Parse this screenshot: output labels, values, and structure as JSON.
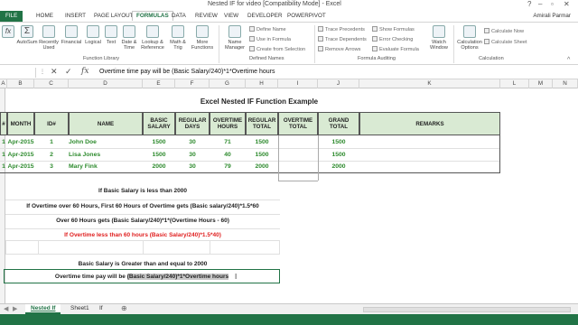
{
  "window": {
    "title": "Nested IF for video  [Compatibility Mode] - Excel"
  },
  "ribbon": {
    "tabs": [
      "FILE",
      "HOME",
      "INSERT",
      "PAGE LAYOUT",
      "FORMULAS",
      "DATA",
      "REVIEW",
      "VIEW",
      "DEVELOPER",
      "POWERPIVOT"
    ],
    "active_tab": "FORMULAS",
    "user": "Amirali Parmar",
    "buttons": {
      "autosum": "AutoSum",
      "recently_used": "Recently Used",
      "financial": "Financial",
      "logical": "Logical",
      "text": "Text",
      "date_time": "Date & Time",
      "lookup": "Lookup & Reference",
      "math": "Math & Trig",
      "more": "More Functions",
      "name_manager": "Name Manager",
      "watch_window": "Watch Window",
      "calc_options": "Calculation Options"
    },
    "small": {
      "define_name": "Define Name",
      "use_in_formula": "Use in Formula",
      "create_from_selection": "Create from Selection",
      "trace_precedents": "Trace Precedents",
      "trace_dependents": "Trace Dependents",
      "remove_arrows": "Remove Arrows",
      "show_formulas": "Show Formulas",
      "error_checking": "Error Checking",
      "evaluate_formula": "Evaluate Formula",
      "calc_now": "Calculate Now",
      "calc_sheet": "Calculate Sheet"
    },
    "groups": {
      "function_library": "Function Library",
      "defined_names": "Defined Names",
      "formula_auditing": "Formula Auditing",
      "calculation": "Calculation"
    }
  },
  "formula_bar": {
    "content": "Overtime time pay will be (Basic Salary/240)*1*Overtime hours"
  },
  "columns": [
    "A",
    "B",
    "C",
    "D",
    "E",
    "F",
    "G",
    "H",
    "I",
    "J",
    "K",
    "L",
    "M",
    "N"
  ],
  "sheet": {
    "title": "Excel Nested IF Function Example",
    "headers": [
      "#",
      "MONTH",
      "ID#",
      "NAME",
      "BASIC SALARY",
      "REGULAR DAYS",
      "OVERTIME HOURS",
      "REGULAR TOTAL",
      "OVERTIME TOTAL",
      "GRAND TOTAL",
      "REMARKS"
    ],
    "rows": [
      {
        "num": "1",
        "month": "Apr-2015",
        "id": "1",
        "name": "John Doe",
        "salary": "1500",
        "days": "30",
        "ot_hours": "71",
        "reg_total": "1500",
        "ot_total": "",
        "grand_total": "1500",
        "remarks": ""
      },
      {
        "num": "1",
        "month": "Apr-2015",
        "id": "2",
        "name": "Lisa Jones",
        "salary": "1500",
        "days": "30",
        "ot_hours": "40",
        "reg_total": "1500",
        "ot_total": "",
        "grand_total": "1500",
        "remarks": ""
      },
      {
        "num": "1",
        "month": "Apr-2015",
        "id": "3",
        "name": "Mary Fink",
        "salary": "2000",
        "days": "30",
        "ot_hours": "79",
        "reg_total": "2000",
        "ot_total": "",
        "grand_total": "2000",
        "remarks": ""
      }
    ],
    "notes": {
      "n1": "If Basic Salary is less than 2000",
      "n2": "If Overtime over 60 Hours, First 60 Hours of Overtime gets (Basic salary/240)*1.5*60",
      "n3": "Over 60 Hours gets (Basic Salary/240)*1*(Overtime Hours - 60)",
      "n4": "If Overtime less than 60 hours (Basic Salary/240)*1.5*40)",
      "n5": "Basic Salary is Greater than and equal to 2000",
      "n6_prefix": "Overtime time pay will be ",
      "n6_highlight": "(Basic Salary/240)*1*Overtime hours"
    },
    "colors": {
      "accent": "#217346",
      "header_fill": "#d9ead3",
      "data_green": "#2e8b2e",
      "red_note": "#e02020"
    }
  },
  "sheet_tabs": [
    "Nested If",
    "Sheet1",
    "If"
  ],
  "active_sheet": "Nested If"
}
